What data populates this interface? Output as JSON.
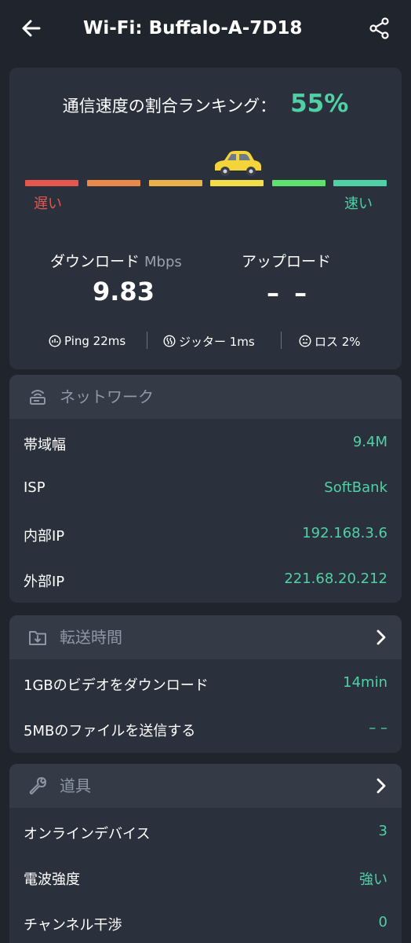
{
  "header": {
    "title": "Wi-Fi: Buffalo-A-7D18",
    "back_icon": "arrow-left-icon",
    "share_icon": "share-icon"
  },
  "speed": {
    "ranking_label": "通信速度の割合ランキング：",
    "ranking_value": "55%",
    "ranking_fraction": 0.55,
    "slow_label": "遅い",
    "fast_label": "速い",
    "bar_colors": [
      "#e4564e",
      "#e8894a",
      "#e9b24a",
      "#f3de4a",
      "#5ee26c",
      "#4fd1a5"
    ],
    "download_label": "ダウンロード",
    "download_unit": "Mbps",
    "download_value": "9.83",
    "upload_label": "アップロード",
    "upload_value": "– –",
    "ping": "Ping 22ms",
    "jitter": "ジッター 1ms",
    "loss": "ロス 2%"
  },
  "network": {
    "title": "ネットワーク",
    "rows": [
      {
        "label": "帯域幅",
        "value": "9.4M"
      },
      {
        "label": "ISP",
        "value": "SoftBank"
      },
      {
        "label": "内部IP",
        "value": "192.168.3.6"
      },
      {
        "label": "外部IP",
        "value": "221.68.20.212"
      }
    ]
  },
  "transfer": {
    "title": "転送時間",
    "rows": [
      {
        "label": "1GBのビデオをダウンロード",
        "value": "14min"
      },
      {
        "label": "5MBのファイルを送信する",
        "value": "– –"
      }
    ]
  },
  "tools": {
    "title": "道具",
    "rows": [
      {
        "label": "オンラインデバイス",
        "value": "3"
      },
      {
        "label": "電波強度",
        "value": "強い"
      },
      {
        "label": "チャンネル干渉",
        "value": "0"
      }
    ]
  },
  "colors": {
    "accent": "#4fd1a5",
    "background": "#1f242d",
    "card": "#2b313c",
    "card_header": "#343b47"
  }
}
